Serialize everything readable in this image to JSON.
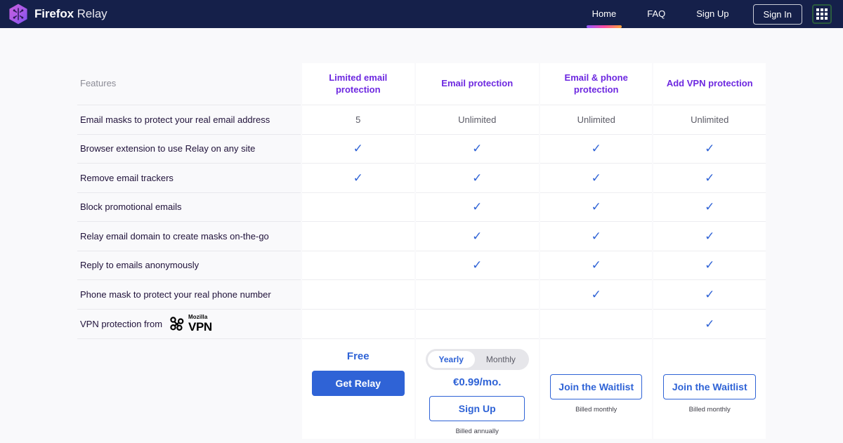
{
  "header": {
    "brand_bold": "Firefox",
    "brand_light": "Relay",
    "logo_icon": "firefox-relay-hexagon-logo",
    "nav": [
      {
        "label": "Home",
        "active": true
      },
      {
        "label": "FAQ",
        "active": false
      },
      {
        "label": "Sign Up",
        "active": false
      }
    ],
    "signin_label": "Sign In",
    "apps_icon": "app-grid-icon",
    "bg_color": "#15204a",
    "underline_gradient": [
      "#9059ff",
      "#ff4aa2",
      "#ffa436"
    ]
  },
  "table": {
    "features_header": "Features",
    "columns": [
      "Limited email protection",
      "Email protection",
      "Email & phone protection",
      "Add VPN protection"
    ],
    "column_header_color": "#6d28e0",
    "check_color": "#2f63d6",
    "check_glyph": "✓",
    "rows": [
      {
        "label": "Email masks to protect your real email address",
        "values": [
          "5",
          "Unlimited",
          "Unlimited",
          "Unlimited"
        ]
      },
      {
        "label": "Browser extension to use Relay on any site",
        "values": [
          "check",
          "check",
          "check",
          "check"
        ]
      },
      {
        "label": "Remove email trackers",
        "values": [
          "check",
          "check",
          "check",
          "check"
        ]
      },
      {
        "label": "Block promotional emails",
        "values": [
          "",
          "check",
          "check",
          "check"
        ]
      },
      {
        "label": "Relay email domain to create masks on-the-go",
        "values": [
          "",
          "check",
          "check",
          "check"
        ]
      },
      {
        "label": "Reply to emails anonymously",
        "values": [
          "",
          "check",
          "check",
          "check"
        ]
      },
      {
        "label": "Phone mask to protect your real phone number",
        "values": [
          "",
          "",
          "check",
          "check"
        ]
      },
      {
        "label": "VPN protection from",
        "logo": "mozilla-vpn-logo",
        "logo_line1": "Mozilla",
        "logo_line2": "VPN",
        "values": [
          "",
          "",
          "",
          "check"
        ]
      }
    ]
  },
  "pricing": {
    "col1": {
      "price": "Free",
      "cta": "Get Relay"
    },
    "col2": {
      "toggle": {
        "options": [
          "Yearly",
          "Monthly"
        ],
        "selected": "Yearly"
      },
      "price": "€0.99/mo.",
      "cta": "Sign Up",
      "note": "Billed annually"
    },
    "col3": {
      "cta": "Join the Waitlist",
      "note": "Billed monthly"
    },
    "col4": {
      "cta": "Join the Waitlist",
      "note": "Billed monthly"
    }
  }
}
